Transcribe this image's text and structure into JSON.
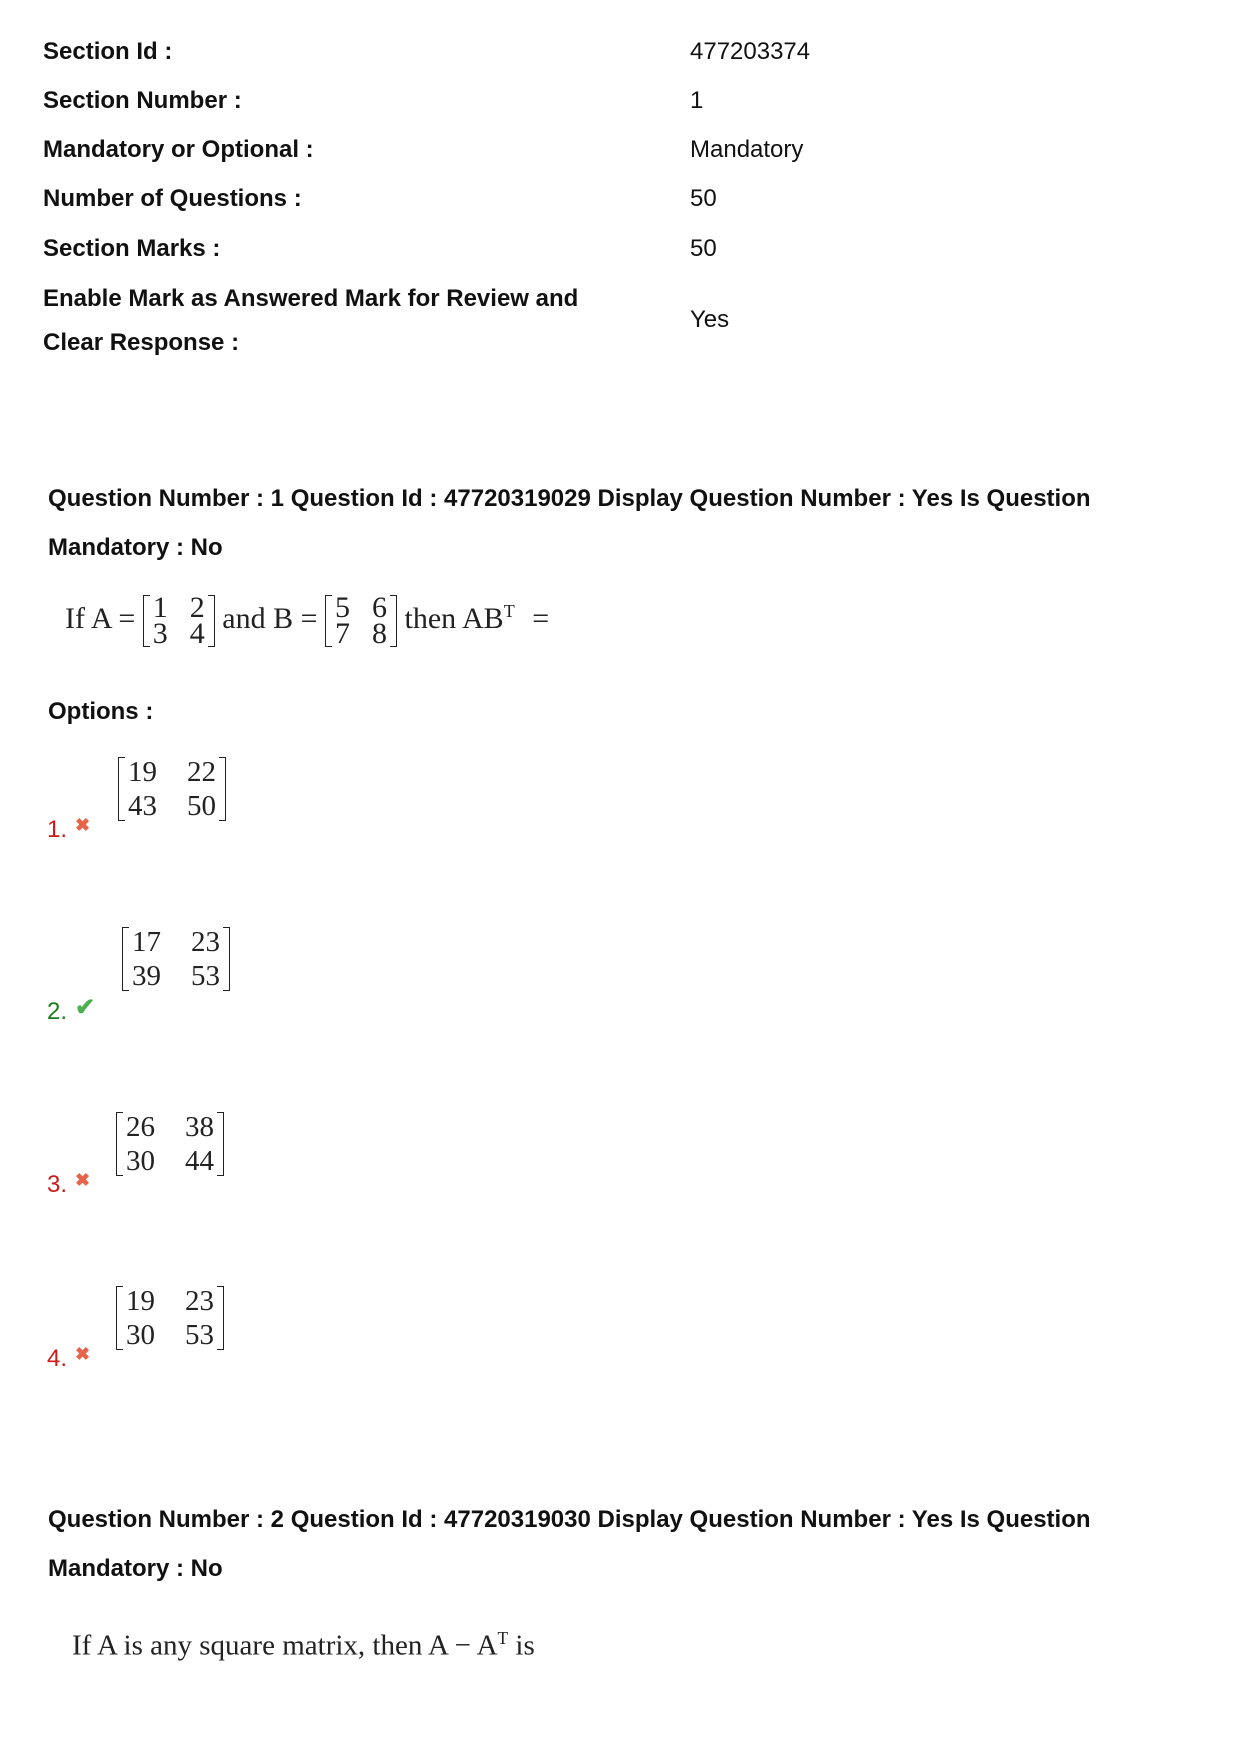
{
  "section_info": [
    {
      "label": "Section Id :",
      "value": "477203374"
    },
    {
      "label": "Section Number :",
      "value": "1"
    },
    {
      "label": "Mandatory or Optional :",
      "value": "Mandatory"
    },
    {
      "label": "Number of Questions :",
      "value": "50"
    },
    {
      "label": "Section Marks :",
      "value": "50"
    },
    {
      "label_line1": "Enable Mark as Answered Mark for Review and",
      "label_line2": "Clear Response :",
      "value": "Yes"
    }
  ],
  "questions": [
    {
      "header_line1": "Question Number : 1 Question Id : 47720319029 Display Question Number : Yes Is Question",
      "header_line2": "Mandatory : No",
      "stem": {
        "prefix": "If A =",
        "matrix_a": [
          "1",
          "2",
          "3",
          "4"
        ],
        "middle": "and B =",
        "matrix_b": [
          "5",
          "6",
          "7",
          "8"
        ],
        "suffix_base": "then AB",
        "suffix_sup": "T",
        "suffix_end": "="
      },
      "options_label": "Options :",
      "options": [
        {
          "number": "1.",
          "status": "wrong",
          "icon": "cross-icon",
          "glyph": "✖",
          "matrix": [
            "19",
            "22",
            "43",
            "50"
          ]
        },
        {
          "number": "2.",
          "status": "correct",
          "icon": "check-icon",
          "glyph": "✔",
          "matrix": [
            "17",
            "23",
            "39",
            "53"
          ]
        },
        {
          "number": "3.",
          "status": "wrong",
          "icon": "cross-icon",
          "glyph": "✖",
          "matrix": [
            "26",
            "38",
            "30",
            "44"
          ]
        },
        {
          "number": "4.",
          "status": "wrong",
          "icon": "cross-icon",
          "glyph": "✖",
          "matrix": [
            "19",
            "23",
            "30",
            "53"
          ]
        }
      ]
    },
    {
      "header_line1": "Question Number : 2 Question Id : 47720319030 Display Question Number : Yes Is Question",
      "header_line2": "Mandatory : No",
      "stem": {
        "text_base": "If A is any square matrix, then A − A",
        "text_sup": "T",
        "text_end": " is"
      }
    }
  ],
  "colors": {
    "wrong": "#cc1a1a",
    "correct": "#1d7a1d",
    "cross_icon": "#e8634a",
    "check_icon": "#4caf50"
  }
}
